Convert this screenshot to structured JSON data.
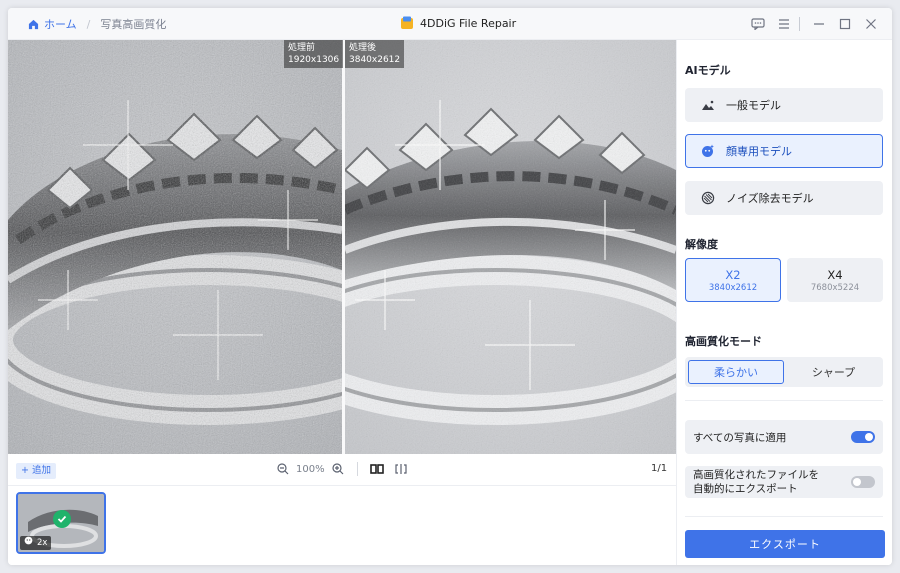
{
  "titlebar": {
    "home_label": "ホーム",
    "separator": "/",
    "page_label": "写真高画質化",
    "app_title": "4DDiG File Repair"
  },
  "preview": {
    "before_label": "処理前",
    "before_size": "1920x1306",
    "after_label": "処理後",
    "after_size": "3840x2612"
  },
  "toolbar": {
    "add_label": "+ 追加",
    "zoom_value": "100%",
    "page_indicator": "1/1"
  },
  "thumbnail": {
    "scale_label": "2x"
  },
  "sidebar": {
    "ai_model_heading": "AIモデル",
    "models": [
      {
        "label": "一般モデル",
        "icon": "mountain-icon",
        "active": false
      },
      {
        "label": "顔専用モデル",
        "icon": "face-icon",
        "active": true
      },
      {
        "label": "ノイズ除去モデル",
        "icon": "noise-icon",
        "active": false
      }
    ],
    "resolution_heading": "解像度",
    "resolutions": [
      {
        "label": "X2",
        "size": "3840x2612",
        "active": true
      },
      {
        "label": "X4",
        "size": "7680x5224",
        "active": false
      }
    ],
    "mode_heading": "高画質化モード",
    "modes": [
      {
        "label": "柔らかい",
        "active": true
      },
      {
        "label": "シャープ",
        "active": false
      }
    ],
    "apply_all_label": "すべての写真に適用",
    "apply_all_on": true,
    "auto_export_label_1": "高画質化されたファイルを",
    "auto_export_label_2": "自動的にエクスポート",
    "auto_export_on": false,
    "export_label": "エクスポート"
  },
  "colors": {
    "accent": "#3f73e8",
    "success": "#1fb36b"
  }
}
